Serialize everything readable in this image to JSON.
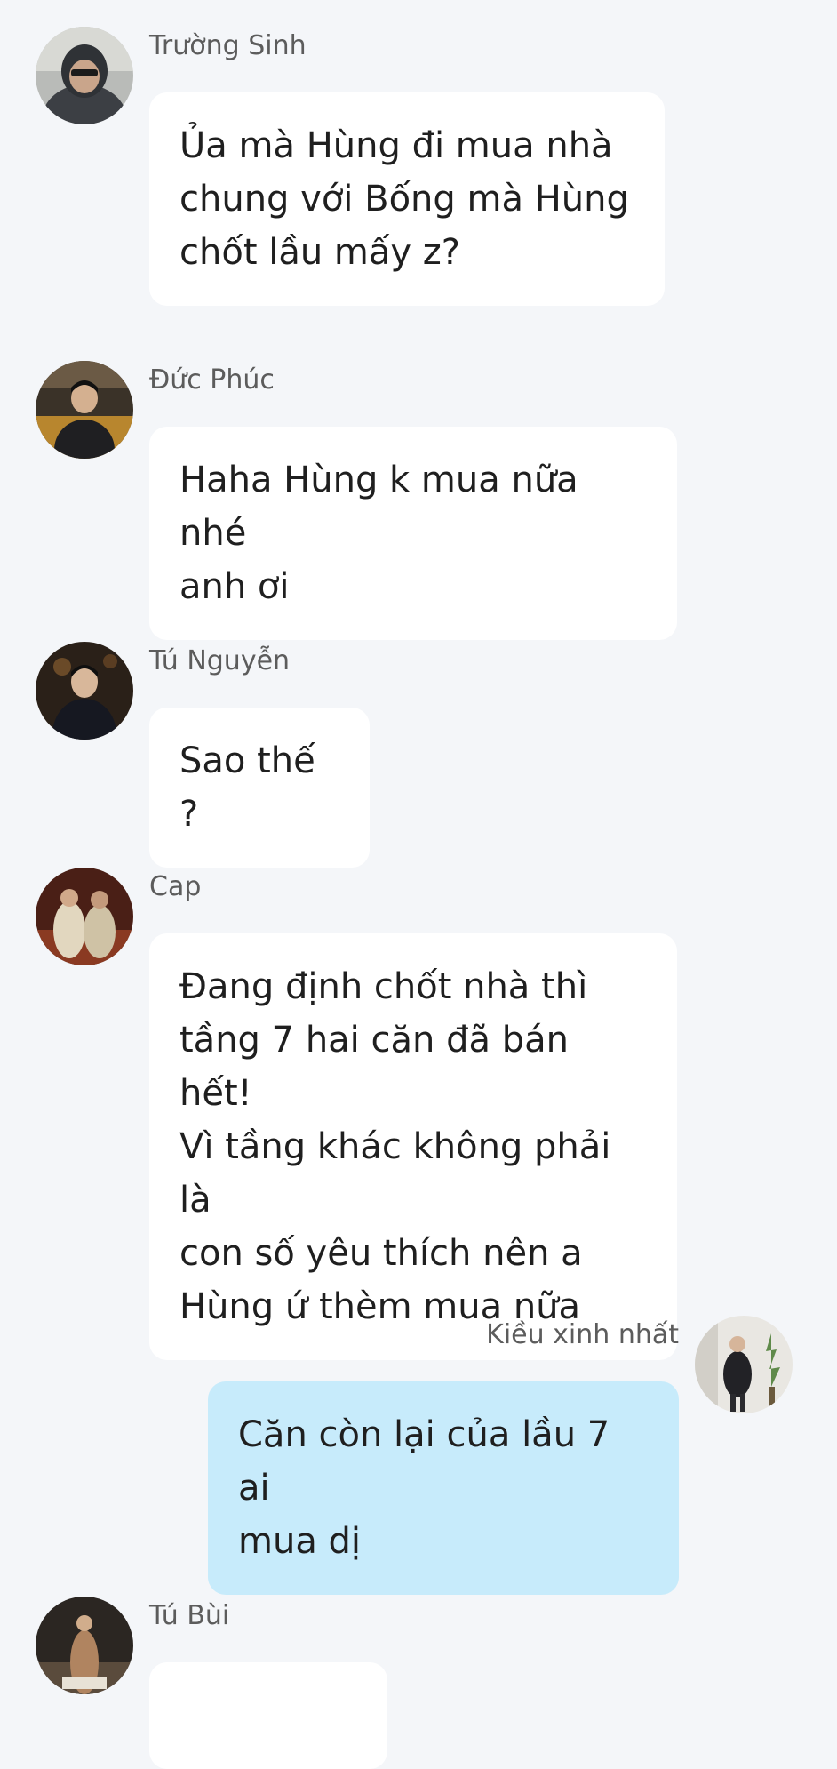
{
  "messages": [
    {
      "sender": "Trường Sinh",
      "text": "Ủa mà Hùng đi mua nhà\nchung với Bống mà Hùng\nchốt lầu mấy z?",
      "mine": false
    },
    {
      "sender": "Đức Phúc",
      "text": "Haha Hùng k mua nữa nhé\nanh ơi",
      "mine": false
    },
    {
      "sender": "Tú Nguyễn",
      "text": "Sao thế ?",
      "mine": false
    },
    {
      "sender": "Cap",
      "text": "Đang định chốt nhà thì\ntầng 7 hai căn đã bán hết!\nVì tầng khác không phải là\ncon số yêu thích nên a\nHùng ứ thèm mua nữa",
      "mine": false
    },
    {
      "sender": "Kiều xinh nhất",
      "text": "Căn còn lại của lầu 7 ai\nmua dị",
      "mine": true
    },
    {
      "sender": "Tú Bùi",
      "text": "",
      "mine": false
    }
  ],
  "colors": {
    "background": "#f4f6f9",
    "bubble_incoming": "#ffffff",
    "bubble_outgoing": "#c7ebfb",
    "sender_text": "#5c5c5c",
    "message_text": "#1f1f1f"
  }
}
